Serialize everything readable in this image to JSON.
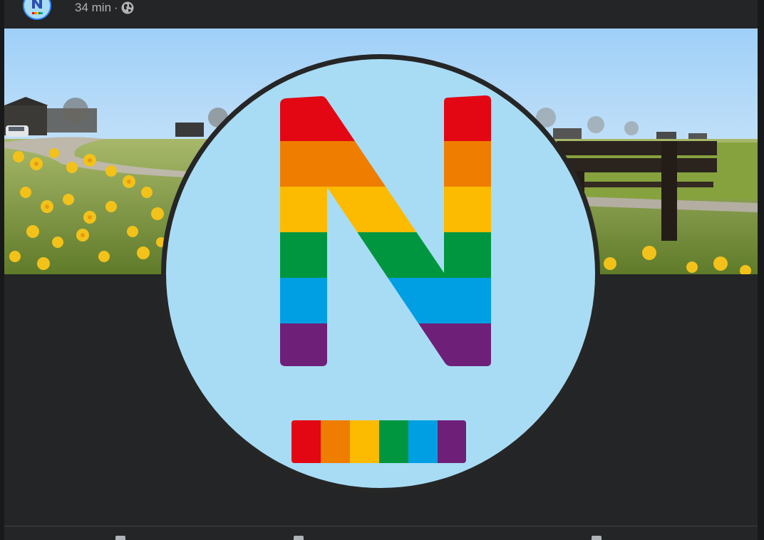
{
  "post": {
    "timestamp": "34 min",
    "separator": "·",
    "privacy_icon": "globe-icon"
  },
  "logo": {
    "letter": "N",
    "stripe_colors": [
      "#e30613",
      "#ef7d00",
      "#fcbb00",
      "#009640",
      "#009fe3",
      "#6e2079"
    ],
    "background": "#a8dcf5"
  },
  "cover": {
    "description_icon": "spring-meadow-photo"
  }
}
